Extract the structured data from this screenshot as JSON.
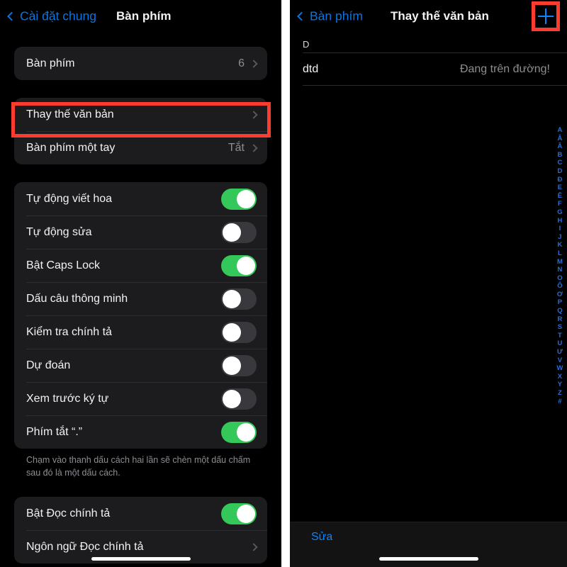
{
  "left_panel": {
    "nav": {
      "back_label": "Cài đặt chung",
      "back_icon": "chevron-left-icon",
      "title": "Bàn phím"
    },
    "group1": [
      {
        "label": "Bàn phím",
        "value": "6",
        "accessory": "chevron-right-icon"
      }
    ],
    "group2": [
      {
        "label": "Thay thế văn bản",
        "value": "",
        "accessory": "chevron-right-icon"
      },
      {
        "label": "Bàn phím một tay",
        "value": "Tắt",
        "accessory": "chevron-right-icon"
      }
    ],
    "group3": [
      {
        "label": "Tự động viết hoa",
        "state": "on"
      },
      {
        "label": "Tự động sửa",
        "state": "off"
      },
      {
        "label": "Bật Caps Lock",
        "state": "on"
      },
      {
        "label": "Dấu câu thông minh",
        "state": "off"
      },
      {
        "label": "Kiểm tra chính tả",
        "state": "off"
      },
      {
        "label": "Dự đoán",
        "state": "off"
      },
      {
        "label": "Xem trước ký tự",
        "state": "off"
      },
      {
        "label": "Phím tắt “.”",
        "state": "on"
      }
    ],
    "footnote": "Chạm vào thanh dấu cách hai lần sẽ chèn một dấu chấm sau đó là một dấu cách.",
    "group4": [
      {
        "label": "Bật Đọc chính tả",
        "state": "on"
      },
      {
        "label": "Ngôn ngữ Đọc chính tả",
        "accessory": "chevron-right-icon"
      }
    ]
  },
  "right_panel": {
    "nav": {
      "back_label": "Bàn phím",
      "back_icon": "chevron-left-icon",
      "title": "Thay thế văn bản",
      "add_icon": "plus-icon"
    },
    "section_header": "D",
    "entries": [
      {
        "shortcut": "dtd",
        "phrase": "Đang trên đường!"
      }
    ],
    "index_letters": [
      "A",
      "Ă",
      "Â",
      "B",
      "C",
      "D",
      "Đ",
      "E",
      "Ê",
      "F",
      "G",
      "H",
      "I",
      "J",
      "K",
      "L",
      "M",
      "N",
      "O",
      "Ô",
      "Ơ",
      "P",
      "Q",
      "R",
      "S",
      "T",
      "U",
      "Ư",
      "V",
      "W",
      "X",
      "Y",
      "Z",
      "#"
    ],
    "toolbar": {
      "edit_label": "Sửa"
    }
  },
  "annotations": {
    "highlight_color": "#fe3b30",
    "boxes": [
      {
        "target": "Thay thế văn bản"
      },
      {
        "target": "plus-icon"
      }
    ]
  },
  "colors": {
    "accent_blue": "#0a84ff",
    "toggle_on": "#34c759",
    "toggle_off": "#39393d",
    "card_bg": "#1c1c1e",
    "screen_bg": "#000000"
  }
}
